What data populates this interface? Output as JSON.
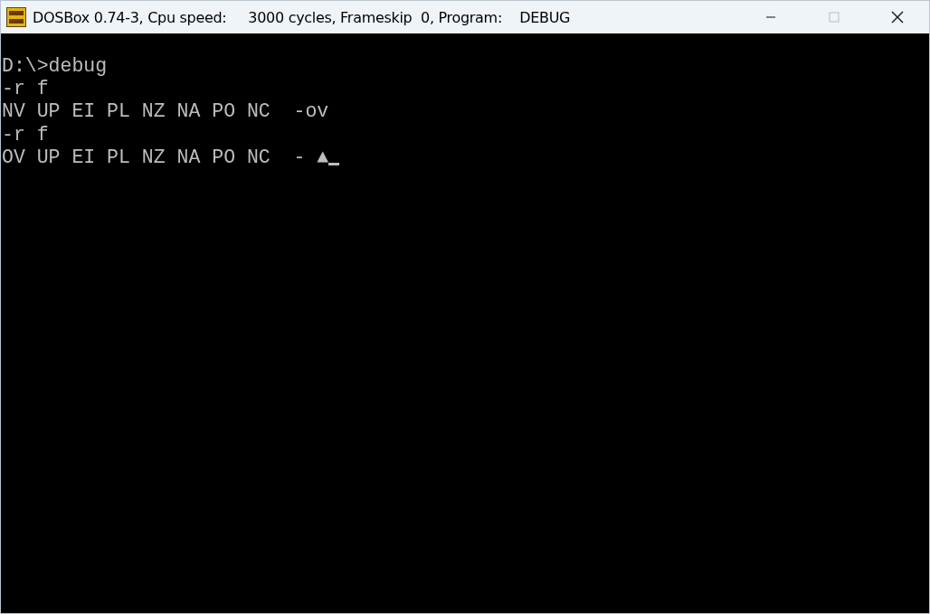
{
  "window": {
    "title": "DOSBox 0.74-3, Cpu speed:     3000 cycles, Frameskip  0, Program:    DEBUG",
    "maximize_disabled": true
  },
  "console": {
    "lines": [
      {
        "text": "D:\\>debug"
      },
      {
        "text": "-r f"
      },
      {
        "text": "NV UP EI PL NZ NA PO NC  -ov"
      },
      {
        "text": "-r f"
      },
      {
        "text": "OV UP EI PL NZ NA PO NC  - ▲",
        "cursor": true
      }
    ]
  }
}
